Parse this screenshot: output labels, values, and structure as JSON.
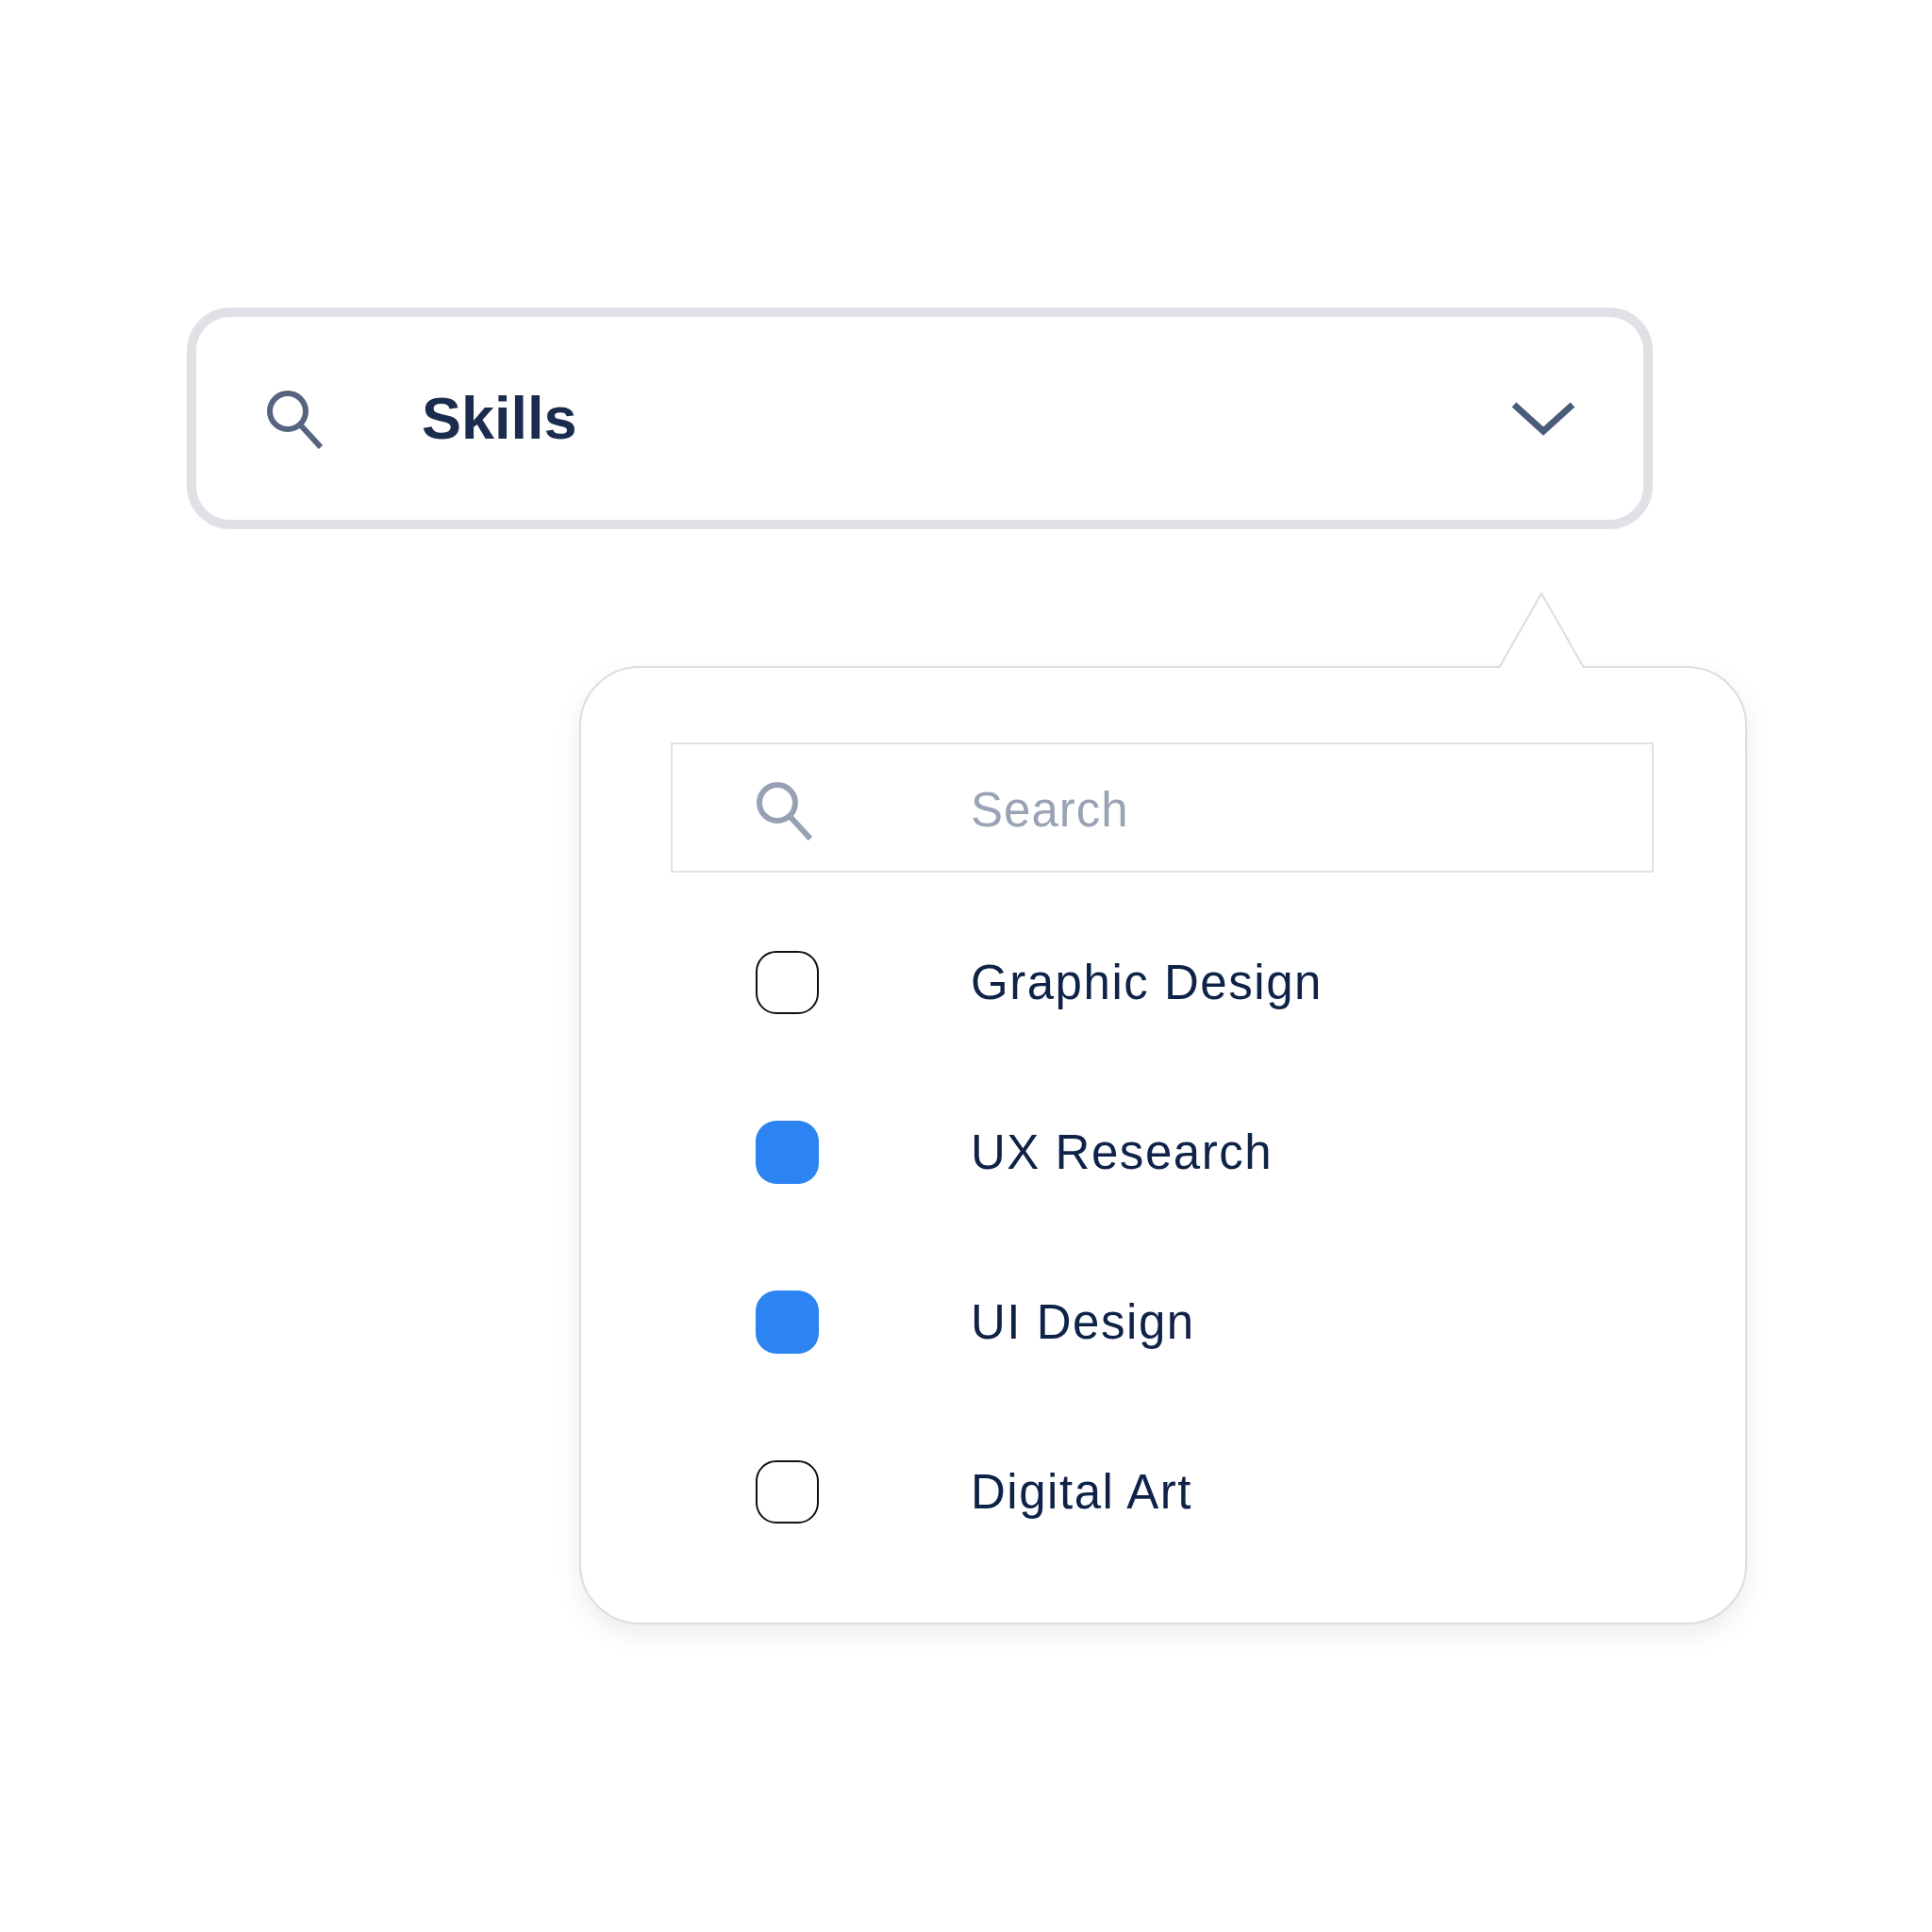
{
  "select": {
    "value": "Skills"
  },
  "dropdown": {
    "search": {
      "placeholder": "Search"
    },
    "options": [
      {
        "label": "Graphic Design",
        "checked": false
      },
      {
        "label": "UX Research",
        "checked": true
      },
      {
        "label": "UI Design",
        "checked": true
      },
      {
        "label": "Digital Art",
        "checked": false
      }
    ]
  }
}
